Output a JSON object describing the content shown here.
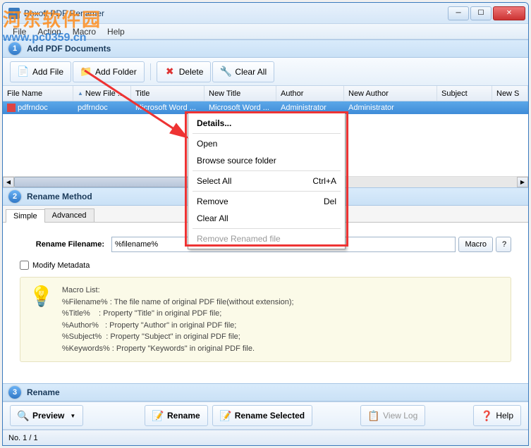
{
  "watermark": {
    "text": "河东软件园",
    "url": "www.pc0359.cn"
  },
  "titlebar": {
    "title": "Boxoft PDF Renamer"
  },
  "menubar": {
    "file": "File",
    "action": "Action",
    "macro": "Macro",
    "help": "Help"
  },
  "section1": {
    "num": "1",
    "title": "Add PDF Documents"
  },
  "toolbar": {
    "add_file": "Add File",
    "add_folder": "Add Folder",
    "delete": "Delete",
    "clear_all": "Clear All"
  },
  "grid": {
    "headers": {
      "file_name": "File Name",
      "new_file": "New File ...",
      "title": "Title",
      "new_title": "New Title",
      "author": "Author",
      "new_author": "New Author",
      "subject": "Subject",
      "new_subject": "New S"
    },
    "row": {
      "file_name": "pdfrndoc",
      "new_file": "pdfrndoc",
      "title": "Microsoft Word ...",
      "new_title": "Microsoft Word ...",
      "author": "Administrator",
      "new_author": "Administrator"
    }
  },
  "context_menu": {
    "details": "Details...",
    "open": "Open",
    "browse": "Browse source folder",
    "select_all": "Select All",
    "select_all_key": "Ctrl+A",
    "remove": "Remove",
    "remove_key": "Del",
    "clear_all": "Clear All",
    "remove_renamed": "Remove Renamed file"
  },
  "section2": {
    "num": "2",
    "title": "Rename Method"
  },
  "tabs": {
    "simple": "Simple",
    "advanced": "Advanced"
  },
  "form": {
    "rename_label": "Rename Filename:",
    "rename_value": "%filename%",
    "macro_btn": "Macro",
    "help_btn": "?",
    "modify_meta": "Modify Metadata"
  },
  "macro": {
    "heading": "Macro List:",
    "l1": "%Filename% : The file name of original PDF file(without extension);",
    "l2": "%Title%    : Property \"Title\" in original PDF file;",
    "l3": "%Author%   : Property \"Author\" in original PDF file;",
    "l4": "%Subject%  : Property \"Subject\" in original PDF file;",
    "l5": "%Keywords% : Property \"Keywords\" in original PDF file."
  },
  "section3": {
    "num": "3",
    "title": "Rename"
  },
  "bottom": {
    "preview": "Preview",
    "rename": "Rename",
    "rename_sel": "Rename Selected",
    "view_log": "View Log",
    "help": "Help"
  },
  "status": {
    "text": "No. 1 / 1"
  }
}
